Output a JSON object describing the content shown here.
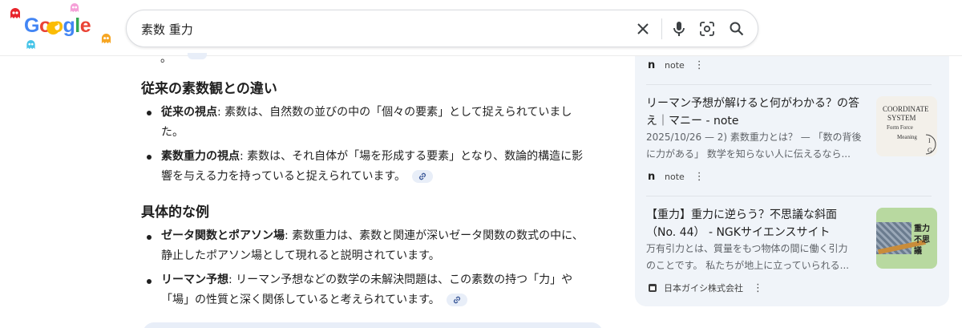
{
  "logo": {
    "text": "Google"
  },
  "search": {
    "query": "素数 重力"
  },
  "main": {
    "top_cut_text": "。",
    "sections": [
      {
        "heading": "従来の素数観との違い",
        "items": [
          {
            "bold": "従来の視点",
            "text": ": 素数は、自然数の並びの中の「個々の要素」として捉えられていまし",
            "text2": "た。"
          },
          {
            "bold": "素数重力の視点",
            "text": ": 素数は、それ自体が「場を形成する要素」となり、数論的構造に影",
            "text2": "響を与える力を持っていると捉えられています。"
          }
        ]
      },
      {
        "heading": "具体的な例",
        "items": [
          {
            "bold": "ゼータ関数とポアソン場",
            "text": ": 素数重力は、素数と関連が深いゼータ関数の数式の中に、",
            "text2": "静止したポアソン場として現れると説明されています。"
          },
          {
            "bold": "リーマン予想",
            "text": ": リーマン予想などの数学の未解決問題は、この素数の持つ「力」や",
            "text2": "「場」の性質と深く関係していると考えられています。"
          }
        ]
      }
    ]
  },
  "sidebar": {
    "top_source": {
      "name": "note"
    },
    "results": [
      {
        "title_line1": "リーマン予想が解けると何がわかる？の答",
        "title_line2": "え｜マニー - note",
        "snippet_line1": "2025/10/26 — 2) 素数重力とは？ — 「数の背後",
        "snippet_line2": "に力がある」 数学を知らない人に伝えるなら...",
        "source": "note",
        "thumb_lines": [
          "COORDINATE",
          "SYSTEM",
          "Form  Force",
          "Meaning"
        ]
      },
      {
        "title_line1": "【重力】重力に逆らう？不思議な斜面",
        "title_line2": "（No. 44） - NGKサイエンスサイト",
        "snippet_line1": "万有引力とは、質量をもつ物体の間に働く引力",
        "snippet_line2": "のことです。 私たちが地上に立っていられる...",
        "source": "日本ガイシ株式会社",
        "thumb_lines": [
          "重力",
          "不思議"
        ]
      }
    ]
  },
  "colors": {
    "accent_chip": "#e8eef8",
    "panel_bg": "#f0f4f9",
    "text": "#1f1f1f",
    "muted": "#5f6368",
    "logo_blue": "#4285f4",
    "logo_red": "#ea4335",
    "logo_yellow": "#fbbc05",
    "logo_green": "#34a853"
  },
  "icons": [
    "clear-icon",
    "microphone-icon",
    "camera-lens-icon",
    "search-icon",
    "link-icon",
    "more-vert-icon",
    "pacman-doodle-icon"
  ]
}
